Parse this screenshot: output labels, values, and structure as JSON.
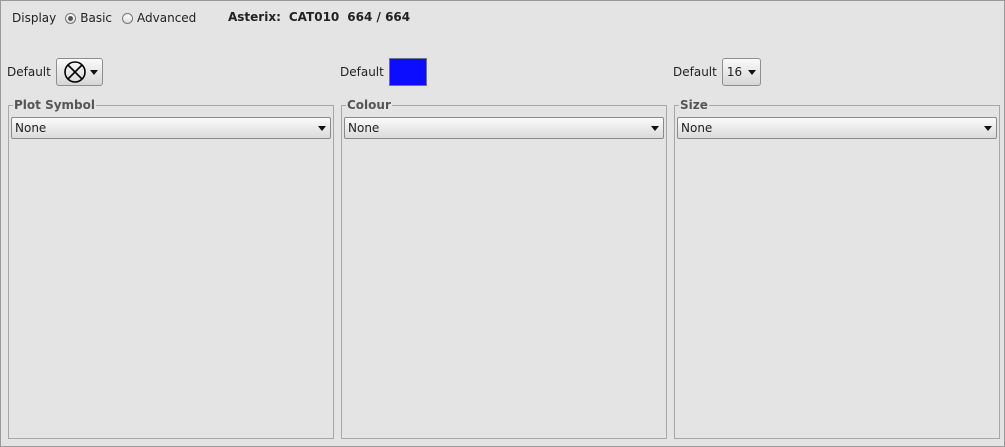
{
  "display": {
    "label": "Display",
    "options": [
      {
        "label": "Basic",
        "selected": true
      },
      {
        "label": "Advanced",
        "selected": false
      }
    ]
  },
  "asterix": {
    "label": "Asterix:",
    "category": "CAT010",
    "count": "664 / 664"
  },
  "defaults": {
    "symbol": {
      "label": "Default",
      "icon": "circle-x-symbol-icon"
    },
    "colour": {
      "label": "Default",
      "color": "#0c0cff"
    },
    "size": {
      "label": "Default",
      "value": "16"
    }
  },
  "panels": [
    {
      "title": "Plot Symbol",
      "selected": "None"
    },
    {
      "title": "Colour",
      "selected": "None"
    },
    {
      "title": "Size",
      "selected": "None"
    }
  ]
}
